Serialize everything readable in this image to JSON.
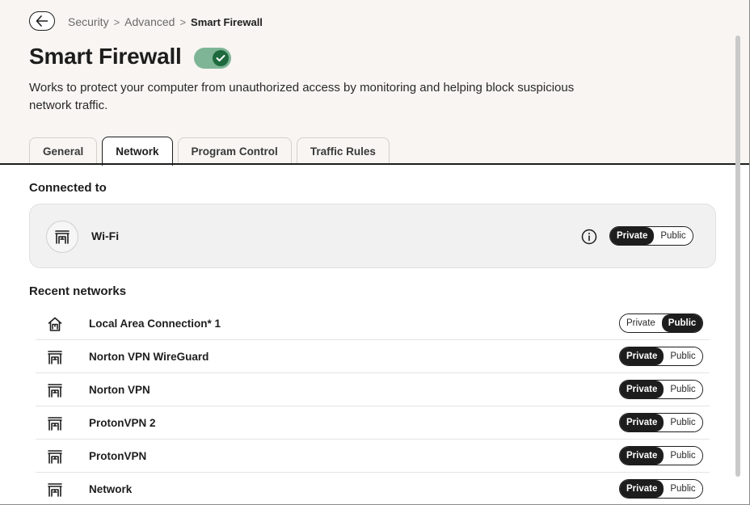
{
  "breadcrumb": {
    "items": [
      "Security",
      "Advanced"
    ],
    "current": "Smart Firewall",
    "separator": ">"
  },
  "page": {
    "title": "Smart Firewall",
    "toggle_state": "on",
    "description": "Works to protect your computer from unauthorized access by monitoring and helping block suspicious network traffic."
  },
  "tabs": [
    {
      "label": "General",
      "active": false
    },
    {
      "label": "Network",
      "active": true
    },
    {
      "label": "Program Control",
      "active": false
    },
    {
      "label": "Traffic Rules",
      "active": false
    }
  ],
  "connected": {
    "section_title": "Connected to",
    "name": "Wi-Fi",
    "icon": "network-icon",
    "selected": "Private",
    "private_label": "Private",
    "public_label": "Public"
  },
  "recent": {
    "section_title": "Recent networks",
    "items": [
      {
        "name": "Local Area Connection* 1",
        "icon": "home-network-icon",
        "selected": "Public",
        "private_label": "Private",
        "public_label": "Public"
      },
      {
        "name": "Norton VPN WireGuard",
        "icon": "network-icon",
        "selected": "Private",
        "private_label": "Private",
        "public_label": "Public"
      },
      {
        "name": "Norton VPN",
        "icon": "network-icon",
        "selected": "Private",
        "private_label": "Private",
        "public_label": "Public"
      },
      {
        "name": "ProtonVPN 2",
        "icon": "network-icon",
        "selected": "Private",
        "private_label": "Private",
        "public_label": "Public"
      },
      {
        "name": "ProtonVPN",
        "icon": "network-icon",
        "selected": "Private",
        "private_label": "Private",
        "public_label": "Public"
      },
      {
        "name": "Network",
        "icon": "network-icon",
        "selected": "Private",
        "private_label": "Private",
        "public_label": "Public"
      }
    ]
  },
  "colors": {
    "accent_dark": "#1d1d1d",
    "toggle_track": "#7eb596",
    "toggle_knob": "#1e6a3e",
    "header_bg": "#f8f5f2",
    "card_bg": "#f1f1f1"
  }
}
